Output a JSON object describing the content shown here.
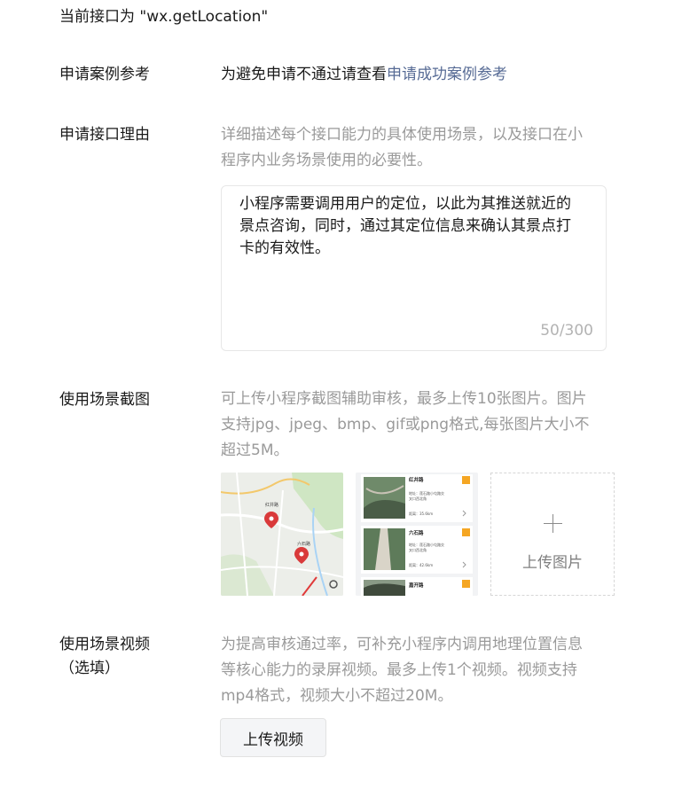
{
  "header": {
    "current_api": "当前接口为 \"wx.getLocation\""
  },
  "case_reference": {
    "label": "申请案例参考",
    "text": "为避免申请不通过请查看",
    "link": "申请成功案例参考"
  },
  "reason": {
    "label": "申请接口理由",
    "hint_line1": "详细描述每个接口能力的具体使用场景，以及接口在小",
    "hint_line2": "程序内业务场景使用的必要性。",
    "value_line1": "小程序需要调用用户的定位，以此为其推送就近的",
    "value_line2": "景点咨询，同时，通过其定位信息来确认其景点打",
    "value_line3": "卡的有效性。",
    "counter": "50/300"
  },
  "screenshots": {
    "label": "使用场景截图",
    "hint_line1": "可上传小程序截图辅助审核，最多上传10张图片。图片",
    "hint_line2": "支持jpg、jpeg、bmp、gif或png格式,每张图片大小不",
    "hint_line3": "超过5M。",
    "upload_label": "上传图片",
    "map_labels": [
      "红井路",
      "六石路"
    ],
    "list_items": [
      {
        "title": "红井路",
        "addr1": "地址：莲石路小屯路交",
        "addr2": "叉口西北角",
        "dist": "距离：35.6km"
      },
      {
        "title": "六石路",
        "addr1": "地址：莲石路小屯路交",
        "addr2": "叉口西北角",
        "dist": "距离：42.6km"
      },
      {
        "title": "嘉开路"
      }
    ]
  },
  "video": {
    "label_line1": "使用场景视频",
    "label_line2": "（选填）",
    "hint_line1": "为提高审核通过率，可补充小程序内调用地理位置信息",
    "hint_line2": "等核心能力的录屏视频。最多上传1个视频。视频支持",
    "hint_line3": "mp4格式，视频大小不超过20M。",
    "button": "上传视频"
  }
}
